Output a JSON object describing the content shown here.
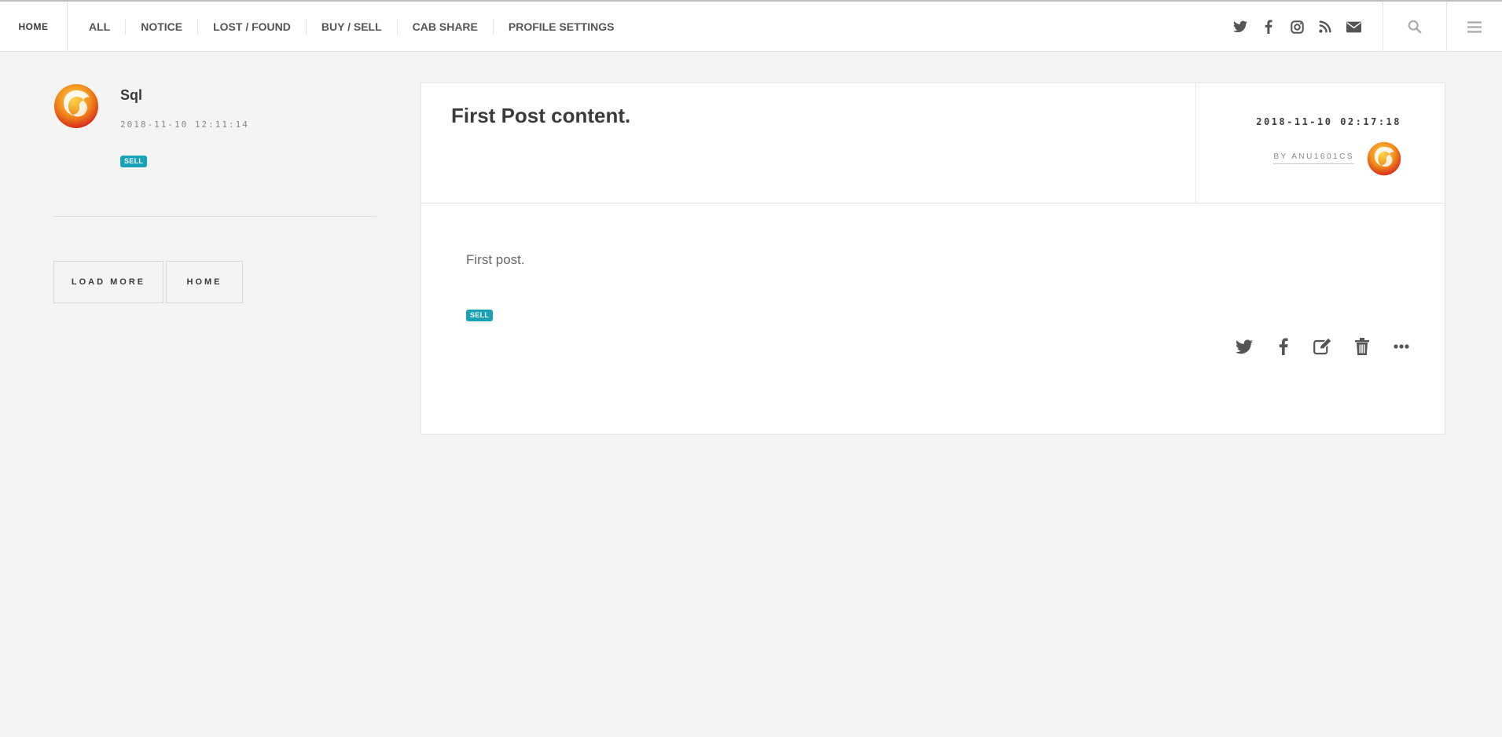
{
  "header": {
    "brand": "HOME",
    "nav": [
      "ALL",
      "NOTICE",
      "LOST / FOUND",
      "BUY / SELL",
      "CAB SHARE",
      "PROFILE SETTINGS"
    ],
    "social_icons": [
      "twitter-icon",
      "facebook-icon",
      "instagram-icon",
      "rss-icon",
      "mail-icon"
    ],
    "search_icon": "search-icon",
    "menu_icon": "hamburger-menu-icon"
  },
  "sidebar": {
    "profile": {
      "name": "Sql",
      "date": "2018-11-10 12:11:14",
      "badge": "SELL",
      "avatar_icon": "firebird-logo-icon"
    },
    "buttons": {
      "load_more": "LOAD MORE",
      "home": "HOME"
    }
  },
  "post": {
    "title": "First Post content.",
    "date": "2018-11-10 02:17:18",
    "author": "BY ANU1601CS",
    "body": "First post.",
    "badge": "SELL",
    "action_icons": [
      "twitter-icon",
      "facebook-icon",
      "edit-icon",
      "trash-icon",
      "more-icon"
    ]
  },
  "colors": {
    "background": "#f4f4f4",
    "card": "#ffffff",
    "badge": "#17a2b8",
    "text": "#3c3b3b",
    "icon": "#555555"
  }
}
